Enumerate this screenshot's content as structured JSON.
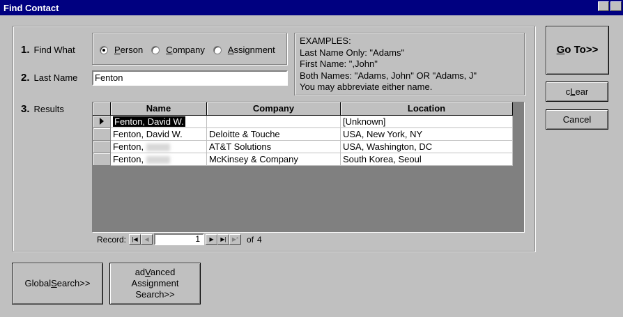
{
  "window": {
    "title": "Find Contact"
  },
  "find_what": {
    "step": "1.",
    "label": "Find What",
    "options": [
      {
        "pre": "",
        "key": "P",
        "post": "erson",
        "selected": true
      },
      {
        "pre": "",
        "key": "C",
        "post": "ompany",
        "selected": false
      },
      {
        "pre": "",
        "key": "A",
        "post": "ssignment",
        "selected": false
      }
    ]
  },
  "last_name": {
    "step": "2.",
    "label": "Last Name",
    "value": "Fenton"
  },
  "examples": {
    "lines": [
      "EXAMPLES:",
      "Last Name Only: \"Adams\"",
      "First Name: \",John\"",
      "Both Names: \"Adams, John\" OR \"Adams, J\"",
      "You may abbreviate either name."
    ]
  },
  "results": {
    "step": "3.",
    "label": "Results",
    "columns": [
      "Name",
      "Company",
      "Location"
    ],
    "rows": [
      {
        "name": "Fenton, David W.",
        "company": "",
        "location": "[Unknown]"
      },
      {
        "name": "Fenton, David W.",
        "company": "Deloitte & Touche",
        "location": "USA, New York, NY"
      },
      {
        "name": "Fenton,",
        "company": "AT&T Solutions",
        "location": "USA, Washington, DC"
      },
      {
        "name": "Fenton,",
        "company": "McKinsey & Company",
        "location": "South Korea, Seoul"
      }
    ]
  },
  "record_nav": {
    "label": "Record:",
    "current": "1",
    "of_label": "of",
    "total": "4"
  },
  "buttons": {
    "goto": {
      "pre": "",
      "key": "G",
      "post": "o To>>"
    },
    "clear": {
      "pre": "c",
      "key": "L",
      "post": "ear"
    },
    "cancel": {
      "label": "Cancel"
    },
    "global_search": {
      "pre": "Global ",
      "key": "S",
      "post": "earch>>"
    },
    "advanced_search": {
      "line1_pre": "ad",
      "line1_key": "V",
      "line1_post": "anced",
      "line2": "Assignment",
      "line3": "Search>>"
    }
  }
}
